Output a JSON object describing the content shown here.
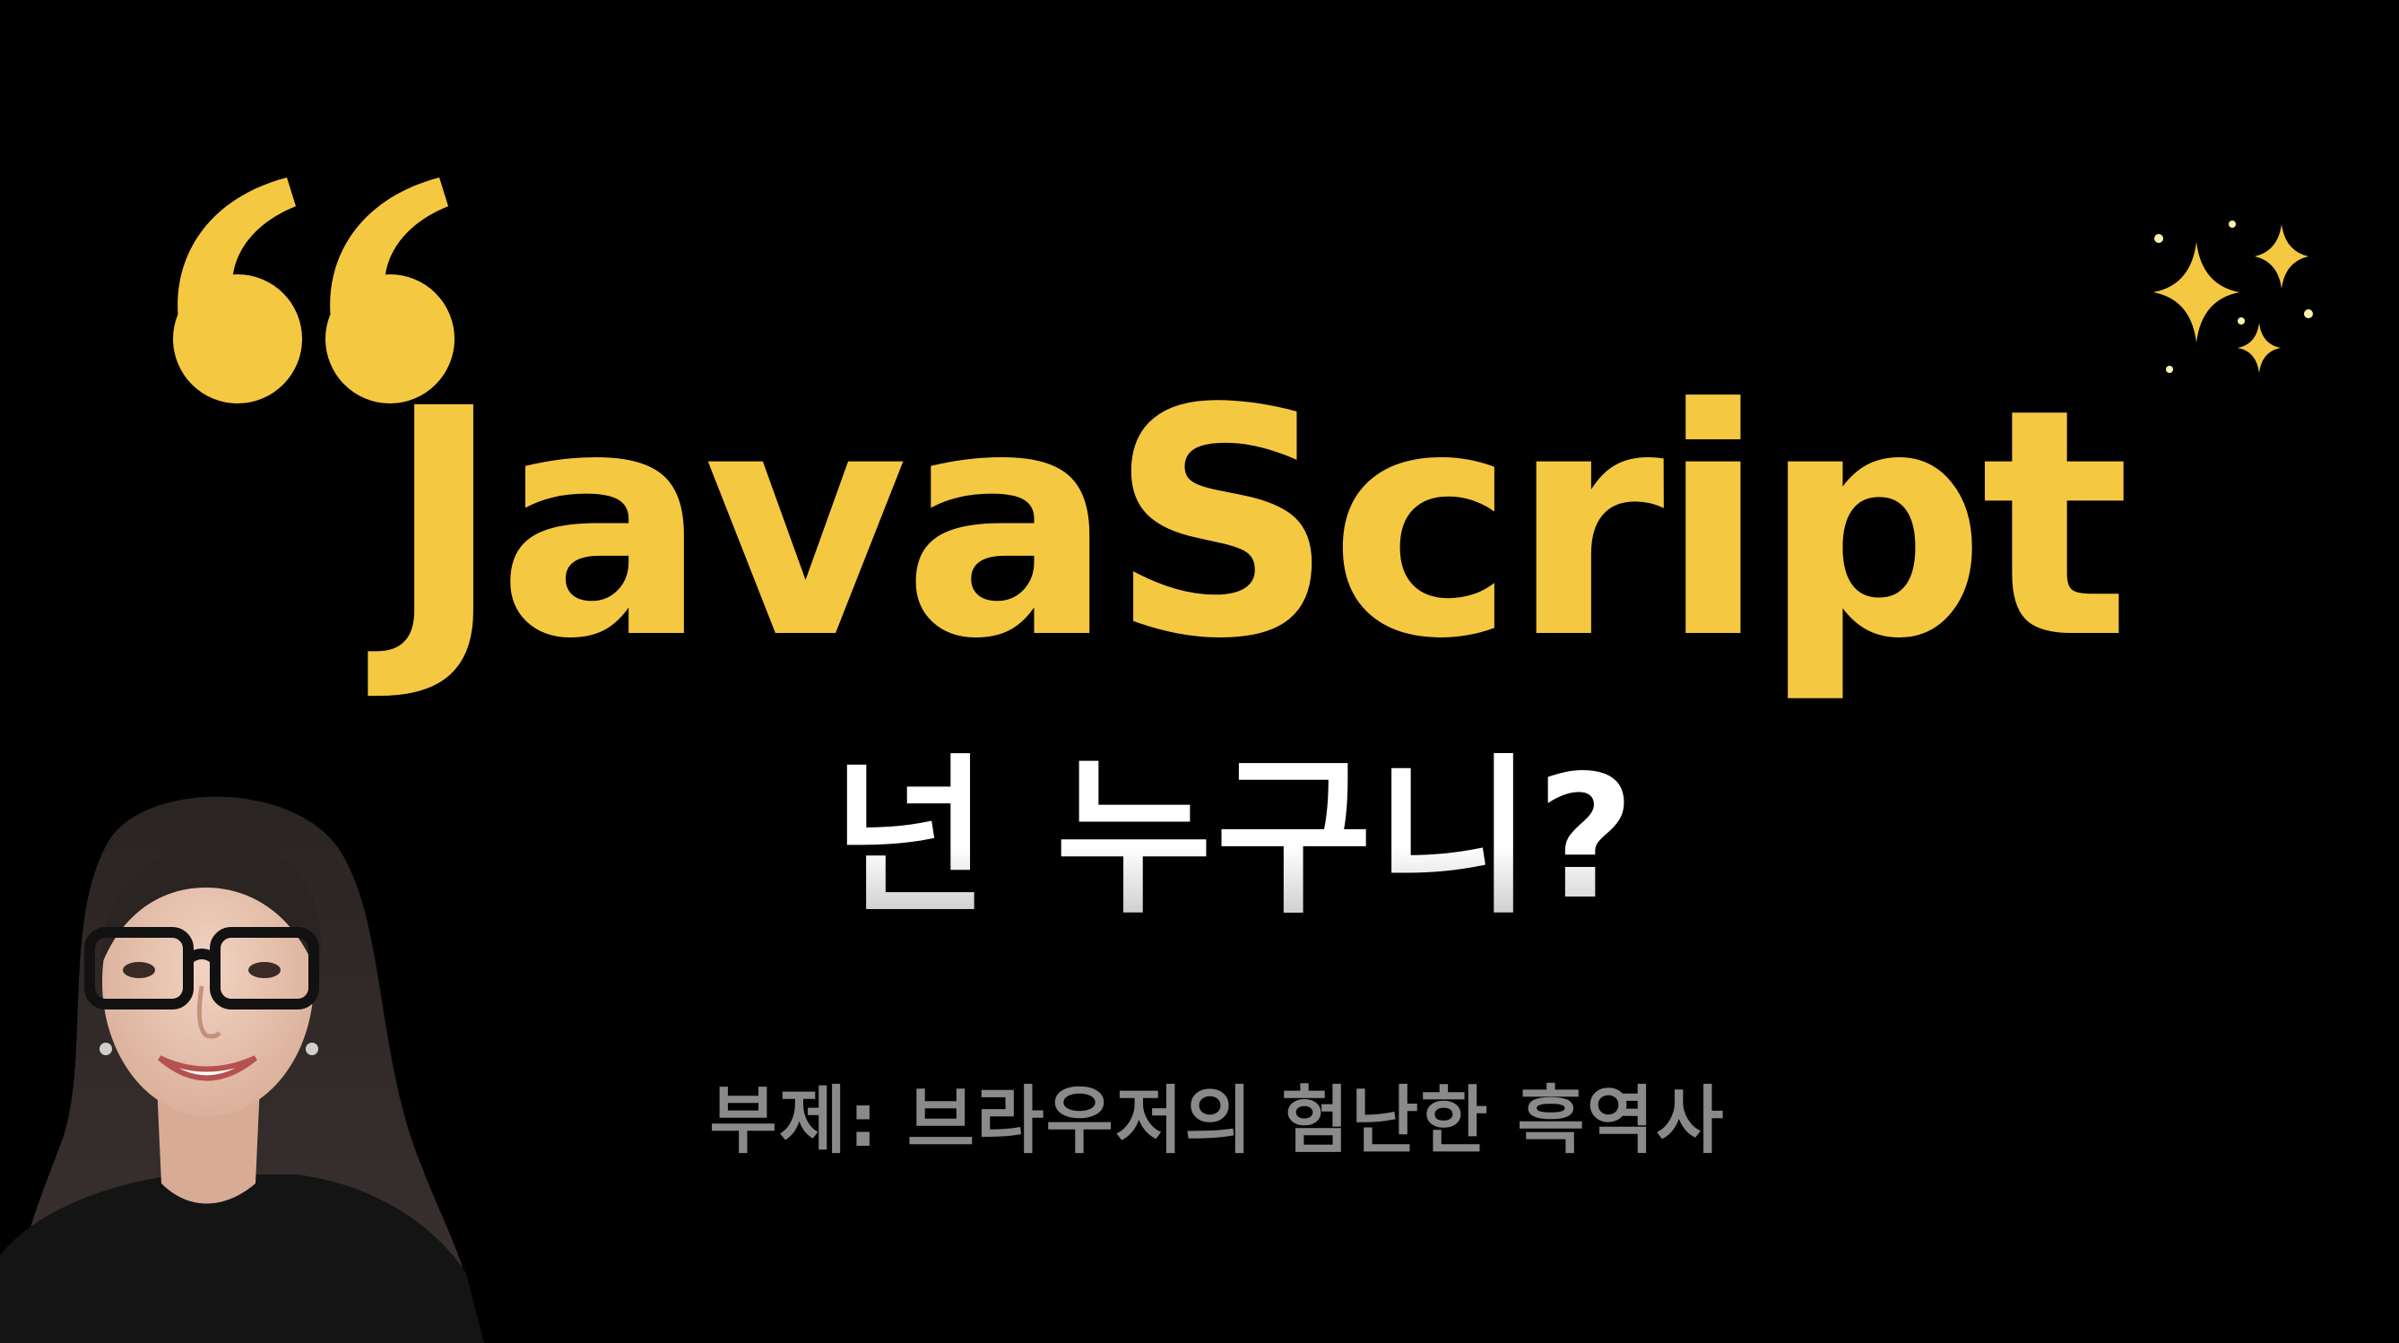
{
  "title": "JavaScript",
  "subtitle": "넌 누구니?",
  "caption": "부제: 브라우저의 험난한 흑역사",
  "colors": {
    "background": "#000000",
    "accent": "#F5C842",
    "subtitle": "#FFFFFF",
    "caption": "#8A8A8A"
  },
  "icons": {
    "quote": "opening-quote-icon",
    "sparkles": "sparkles-icon"
  }
}
